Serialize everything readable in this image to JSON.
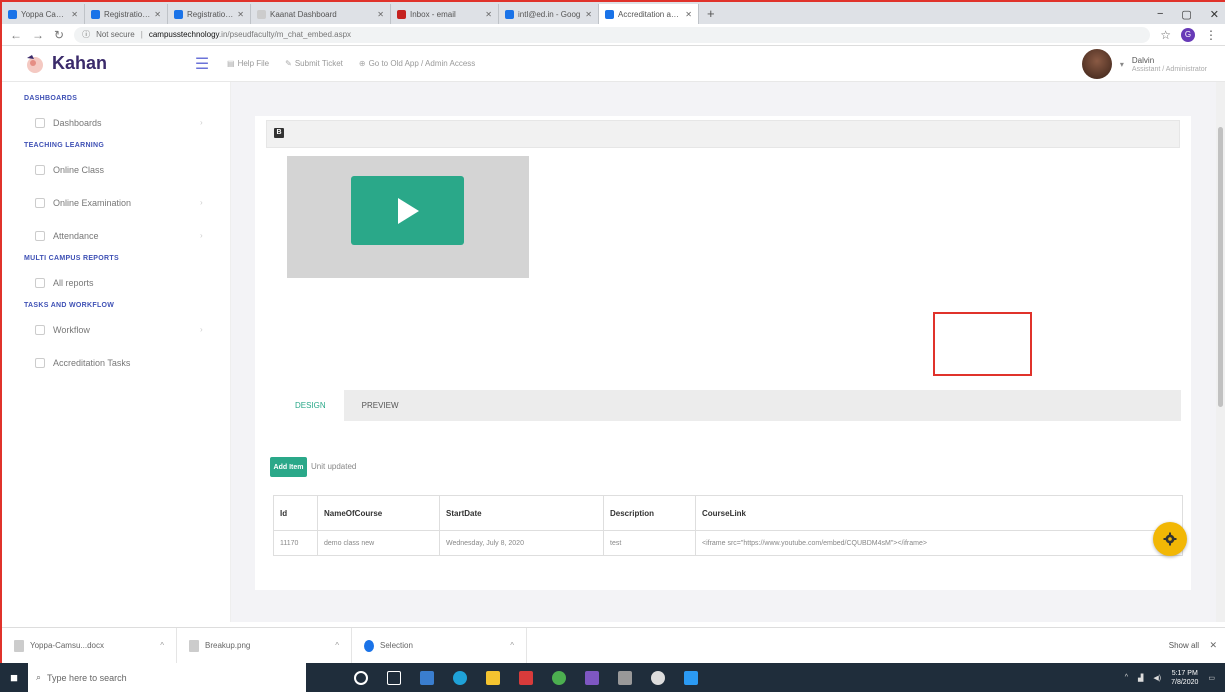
{
  "browser": {
    "tabs": [
      {
        "label": "Yoppa Camsu form",
        "active": false,
        "color": "#1a73e8"
      },
      {
        "label": "Registration Form",
        "active": false,
        "color": "#1a73e8"
      },
      {
        "label": "Registration Form",
        "active": false,
        "color": "#1a73e8"
      },
      {
        "label": "Kaanat Dashboard",
        "active": false,
        "color": "#1a73e8"
      },
      {
        "label": "Inbox - email",
        "active": false,
        "color": "#c5221f"
      },
      {
        "label": "intl@ed.in - Goog",
        "active": false,
        "color": "#1a73e8"
      },
      {
        "label": "Accreditation and C",
        "active": true,
        "color": "#1a73e8"
      }
    ],
    "new_tab": "+",
    "window_controls": [
      "−",
      "▢",
      "✕"
    ],
    "address": {
      "security": "Not secure",
      "host": "campusstechnology",
      "path": ".in/pseudfaculty/m_chat_embed.aspx"
    },
    "profile_initial": "G"
  },
  "app": {
    "logo_text": "Kahan",
    "top_links": [
      "Help File",
      "Submit Ticket",
      "Go to Old App / Admin Access"
    ],
    "user": {
      "name": "Dalvin",
      "role": "Assistant / Administrator"
    }
  },
  "sidebar": {
    "sections": [
      {
        "title": "DASHBOARDS",
        "items": [
          "Dashboards"
        ]
      },
      {
        "title": "TEACHING LEARNING",
        "items": [
          "Online Class",
          "Online Examination",
          "Attendance"
        ]
      },
      {
        "title": "MULTI CAMPUS REPORTS",
        "items": [
          "All reports"
        ]
      },
      {
        "title": "TASKS AND WORKFLOW",
        "items": [
          "Workflow",
          "Accreditation Tasks"
        ]
      }
    ]
  },
  "editor": {
    "toolbar_icon": "B",
    "tabs": [
      {
        "label": "DESIGN",
        "active": true
      },
      {
        "label": "PREVIEW",
        "active": false
      }
    ],
    "add_button": "Add Item",
    "status_text": "Unit updated"
  },
  "table": {
    "headers": [
      "Id",
      "NameOfCourse",
      "StartDate",
      "Description",
      "CourseLink"
    ],
    "rows": [
      [
        "11170",
        "demo class new",
        "Wednesday, July 8, 2020",
        "test",
        "<iframe src=\"https://www.youtube.com/embed/CQUBDM4sM\"></iframe>"
      ]
    ]
  },
  "downloads": {
    "items": [
      "Yoppa-Camsu...docx",
      "Breakup.png",
      "Selection"
    ],
    "show_all": "Show all"
  },
  "taskbar": {
    "search_placeholder": "Type here to search",
    "time": "5:17 PM",
    "date": "7/8/2020"
  },
  "colors": {
    "accent": "#2aa889",
    "brand": "#3f51b5",
    "highlight": "#e0322b",
    "gear": "#f2b705"
  }
}
